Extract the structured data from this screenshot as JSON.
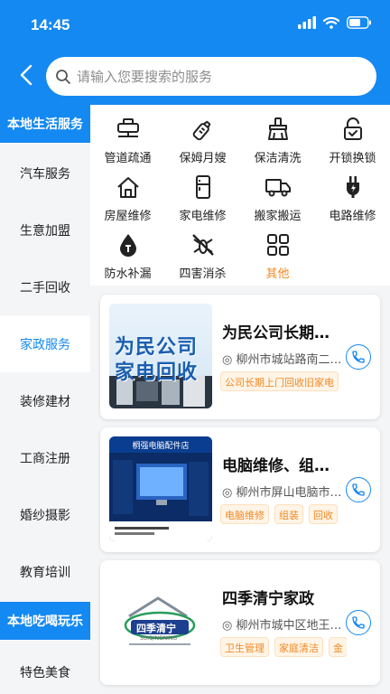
{
  "status": {
    "time": "14:45"
  },
  "search": {
    "placeholder": "请输入您要搜索的服务"
  },
  "sidebar": {
    "items": [
      {
        "label": "本地生活服务",
        "type": "header"
      },
      {
        "label": "汽车服务"
      },
      {
        "label": "生意加盟"
      },
      {
        "label": "二手回收"
      },
      {
        "label": "家政服务",
        "active": true
      },
      {
        "label": "装修建材"
      },
      {
        "label": "工商注册"
      },
      {
        "label": "婚纱摄影"
      },
      {
        "label": "教育培训"
      },
      {
        "label": "本地吃喝玩乐",
        "type": "header"
      },
      {
        "label": "特色美食"
      }
    ]
  },
  "services": [
    {
      "label": "管道疏通",
      "icon": "pipe-icon"
    },
    {
      "label": "保姆月嫂",
      "icon": "baby-bottle-icon"
    },
    {
      "label": "保洁清洗",
      "icon": "broom-icon"
    },
    {
      "label": "开锁换锁",
      "icon": "lock-icon"
    },
    {
      "label": "房屋维修",
      "icon": "house-icon"
    },
    {
      "label": "家电维修",
      "icon": "fridge-icon"
    },
    {
      "label": "搬家搬运",
      "icon": "truck-icon"
    },
    {
      "label": "电路维修",
      "icon": "plug-icon"
    },
    {
      "label": "防水补漏",
      "icon": "water-drop-icon"
    },
    {
      "label": "四害消杀",
      "icon": "no-mosquito-icon"
    },
    {
      "label": "其他",
      "icon": "grid-icon"
    }
  ],
  "listings": [
    {
      "title": "为民公司长期…",
      "address": "柳州市城站路南二…",
      "tags": [
        "公司长期上门回收旧家电"
      ],
      "thumb_text": [
        "为民公司",
        "家电回收"
      ]
    },
    {
      "title": "电脑维修、组…",
      "address": "柳州市屏山电脑市…",
      "tags": [
        "电脑维修",
        "组装",
        "回收"
      ],
      "thumb_text": [
        "桐强电脑配件店"
      ]
    },
    {
      "title": "四季清宁家政",
      "address": "柳州市城中区地王…",
      "tags": [
        "卫生管理",
        "家庭清洁",
        "金"
      ],
      "thumb_text": [
        "四季清宁",
        "SUIQINGNING"
      ]
    }
  ],
  "colors": {
    "primary": "#1489f2",
    "accent": "#f08a24",
    "background": "#f4f5f7"
  }
}
